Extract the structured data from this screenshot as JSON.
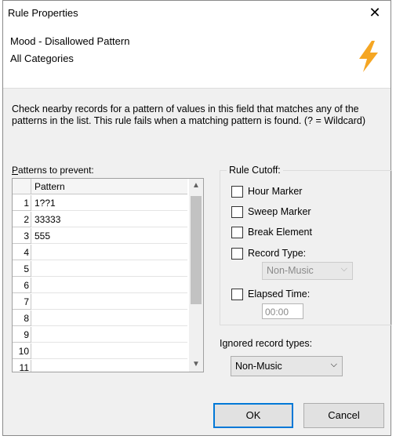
{
  "window": {
    "title": "Rule Properties"
  },
  "header": {
    "line1": "Mood - Disallowed Pattern",
    "line2": "All Categories"
  },
  "description": "Check nearby records for a pattern of values in this field that matches any of the patterns in the list. This rule fails when a matching pattern is found. (? = Wildcard)",
  "patterns": {
    "label_prefix": "P",
    "label_rest": "atterns to prevent:",
    "column_header": "Pattern",
    "rows": [
      {
        "num": "1",
        "value": "1??1"
      },
      {
        "num": "2",
        "value": "33333"
      },
      {
        "num": "3",
        "value": "555"
      },
      {
        "num": "4",
        "value": ""
      },
      {
        "num": "5",
        "value": ""
      },
      {
        "num": "6",
        "value": ""
      },
      {
        "num": "7",
        "value": ""
      },
      {
        "num": "8",
        "value": ""
      },
      {
        "num": "9",
        "value": ""
      },
      {
        "num": "10",
        "value": ""
      },
      {
        "num": "11",
        "value": ""
      }
    ]
  },
  "cutoff": {
    "label": "Rule Cutoff:",
    "hour_marker": "Hour Marker",
    "sweep_marker": "Sweep Marker",
    "break_element": "Break Element",
    "record_type": "Record Type:",
    "record_type_value": "Non-Music",
    "elapsed_time": "Elapsed Time:",
    "elapsed_value": "00:00"
  },
  "ignored": {
    "label": "Ignored record types:",
    "value": "Non-Music"
  },
  "buttons": {
    "ok": "OK",
    "cancel": "Cancel"
  },
  "colors": {
    "accent": "#0078d7",
    "bolt": "#f5a623"
  }
}
